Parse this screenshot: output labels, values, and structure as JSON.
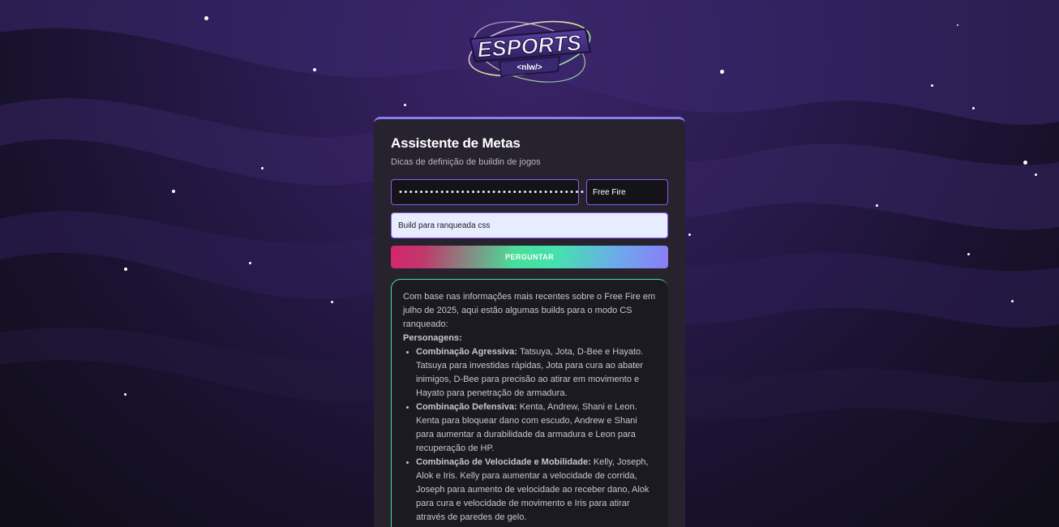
{
  "logo": {
    "title": "ESPORTS",
    "tagline": "<nlw/>"
  },
  "form": {
    "title": "Assistente de Metas",
    "subtitle": "Dicas de definição de buildin de jogos",
    "api_key_masked": "••••••••••••••••••••••••••••••••••••••",
    "game_selected": "Free Fire",
    "question_value": "Build para ranqueada css",
    "ask_label": "PERGUNTAR"
  },
  "answer": {
    "intro": "Com base nas informações mais recentes sobre o Free Fire em julho de 2025, aqui estão algumas builds para o modo CS ranqueado:",
    "section_heading": "Personagens:",
    "items": [
      {
        "title": "Combinação Agressiva:",
        "text": "Tatsuya, Jota, D-Bee e Hayato. Tatsuya para investidas rápidas, Jota para cura ao abater inimigos, D-Bee para precisão ao atirar em movimento e Hayato para penetração de armadura."
      },
      {
        "title": "Combinação Defensiva:",
        "text": "Kenta, Andrew, Shani e Leon. Kenta para bloquear dano com escudo, Andrew e Shani para aumentar a durabilidade da armadura e Leon para recuperação de HP."
      },
      {
        "title": "Combinação de Velocidade e Mobilidade:",
        "text": "Kelly, Joseph, Alok e Iris. Kelly para aumentar a velocidade de corrida, Joseph para aumento de velocidade ao receber dano, Alok para cura e velocidade de movimento e Iris para atirar através de paredes de gelo."
      }
    ]
  },
  "colors": {
    "accent_purple": "#8b5cf6",
    "accent_green": "#4ade9a",
    "accent_pink": "#d6246f",
    "card_bg": "#26232e"
  }
}
